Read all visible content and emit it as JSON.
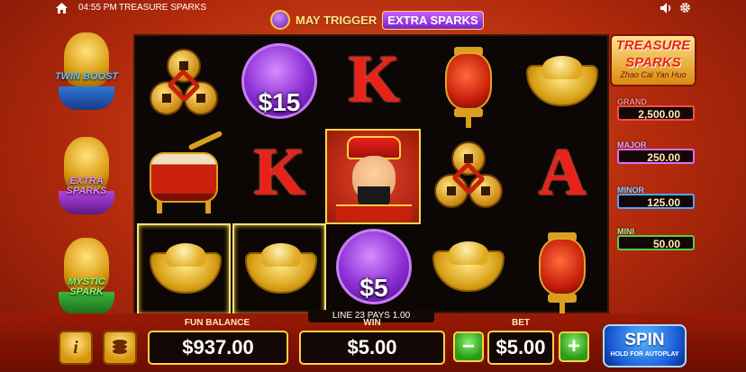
{
  "topbar": {
    "time": "04:55 PM",
    "title": "TREASURE SPARKS"
  },
  "trigger": {
    "text": "MAY TRIGGER",
    "badge": "EXTRA SPARKS"
  },
  "features": [
    {
      "label": "TWIN BOOST"
    },
    {
      "label": "EXTRA SPARKS"
    },
    {
      "label": "MYSTIC SPARK"
    }
  ],
  "reels": [
    [
      {
        "symbol": "coins"
      },
      {
        "symbol": "drum"
      },
      {
        "symbol": "ingot",
        "highlight": true
      }
    ],
    [
      {
        "symbol": "purple-coin",
        "value": "$15"
      },
      {
        "symbol": "k",
        "letter": "K"
      },
      {
        "symbol": "ingot",
        "highlight": true
      }
    ],
    [
      {
        "symbol": "k",
        "letter": "K"
      },
      {
        "symbol": "fortune-god"
      },
      {
        "symbol": "purple-coin",
        "value": "$5"
      }
    ],
    [
      {
        "symbol": "lantern"
      },
      {
        "symbol": "coins"
      },
      {
        "symbol": "ingot"
      }
    ],
    [
      {
        "symbol": "ingot"
      },
      {
        "symbol": "a",
        "letter": "A"
      },
      {
        "symbol": "lantern"
      }
    ]
  ],
  "logo": {
    "line1": "TREASURE",
    "line2": "SPARKS",
    "line3": "Zhao Cai Yan Huo"
  },
  "jackpots": {
    "grand": {
      "name": "GRAND",
      "value": "2,500.00"
    },
    "major": {
      "name": "MAJOR",
      "value": "250.00"
    },
    "minor": {
      "name": "MINOR",
      "value": "125.00"
    },
    "mini": {
      "name": "MINI",
      "value": "50.00"
    }
  },
  "line_pays": "LINE 23 PAYS 1.00",
  "bottom": {
    "balance_label": "FUN BALANCE",
    "balance": "$937.00",
    "win_label": "WIN",
    "win": "$5.00",
    "bet_label": "BET",
    "bet": "$5.00",
    "info": "i",
    "minus": "−",
    "plus": "+",
    "spin": "SPIN",
    "spin_sub": "HOLD FOR AUTOPLAY"
  }
}
